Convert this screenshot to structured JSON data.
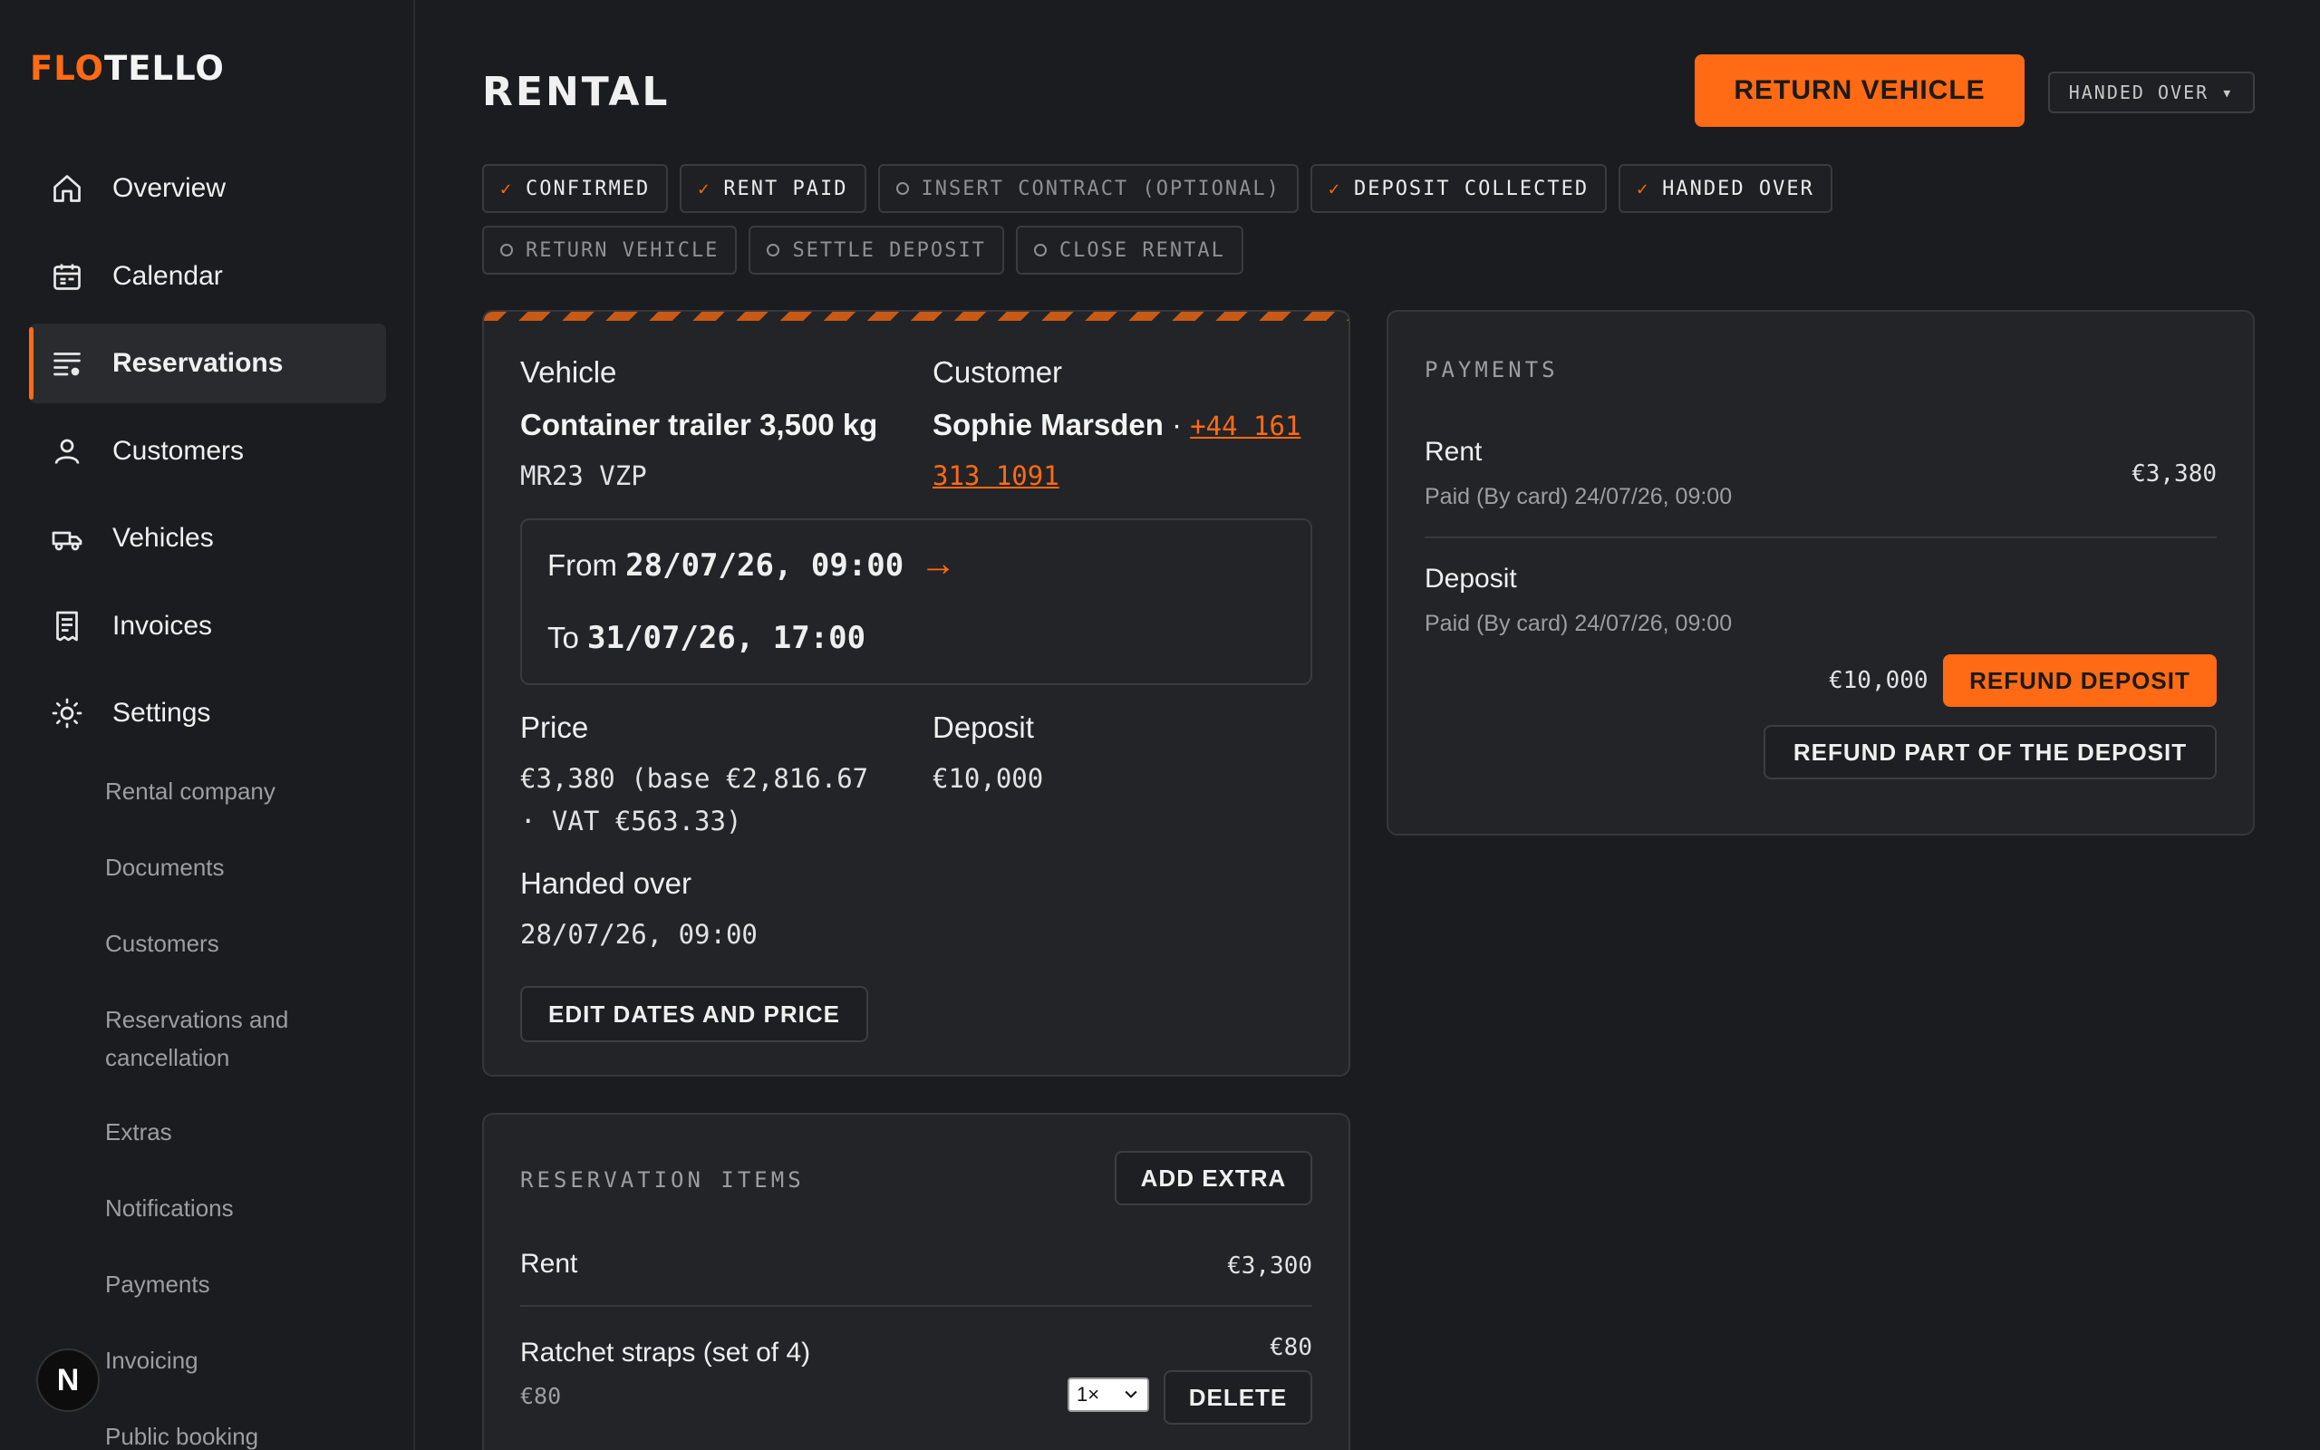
{
  "app": {
    "logo_accent": "FLO",
    "logo_rest": "TELLO",
    "accent_color": "#ff6a14"
  },
  "sidebar": {
    "items": [
      {
        "label": "Overview",
        "icon": "home-icon"
      },
      {
        "label": "Calendar",
        "icon": "calendar-icon"
      },
      {
        "label": "Reservations",
        "icon": "list-icon",
        "active": true
      },
      {
        "label": "Customers",
        "icon": "user-icon"
      },
      {
        "label": "Vehicles",
        "icon": "truck-icon"
      },
      {
        "label": "Invoices",
        "icon": "receipt-icon"
      },
      {
        "label": "Settings",
        "icon": "gear-icon"
      }
    ],
    "settings_items": [
      "Rental company",
      "Documents",
      "Customers",
      "Reservations and cancellation",
      "Extras",
      "Notifications",
      "Payments",
      "Invoicing",
      "Public booking"
    ],
    "avatar_letter": "N"
  },
  "header": {
    "title": "RENTAL",
    "primary_action": "RETURN VEHICLE",
    "status_select": "HANDED OVER ▾"
  },
  "steps": [
    {
      "label": "CONFIRMED",
      "done": true
    },
    {
      "label": "RENT PAID",
      "done": true
    },
    {
      "label": "INSERT CONTRACT (OPTIONAL)",
      "done": false
    },
    {
      "label": "DEPOSIT COLLECTED",
      "done": true
    },
    {
      "label": "HANDED OVER",
      "done": true
    },
    {
      "label": "RETURN VEHICLE",
      "done": false
    },
    {
      "label": "SETTLE DEPOSIT",
      "done": false
    },
    {
      "label": "CLOSE RENTAL",
      "done": false
    }
  ],
  "rental": {
    "vehicle_label": "Vehicle",
    "vehicle_name": "Container trailer 3,500 kg",
    "plate": "MR23 VZP",
    "customer_label": "Customer",
    "customer_name": "Sophie Marsden",
    "separator": " · ",
    "phone_line1": "+44 161",
    "phone_line2": "313 1091",
    "from_label": "From",
    "from_value": "28/07/26, 09:00",
    "arrow": "→",
    "to_label": "To",
    "to_value": "31/07/26, 17:00",
    "price_label": "Price",
    "price_line1": "€3,380 (base €2,816.67",
    "price_line2": "· VAT €563.33)",
    "deposit_label": "Deposit",
    "deposit_value": "€10,000",
    "handed_label": "Handed over",
    "handed_value": "28/07/26, 09:00",
    "edit_button": "EDIT DATES AND PRICE"
  },
  "payments": {
    "title": "PAYMENTS",
    "rent_label": "Rent",
    "rent_sub": "Paid (By card) 24/07/26, 09:00",
    "rent_amount": "€3,380",
    "deposit_label": "Deposit",
    "deposit_sub": "Paid (By card) 24/07/26, 09:00",
    "deposit_amount": "€10,000",
    "refund_button": "REFUND DEPOSIT",
    "refund_part_button": "REFUND PART OF THE DEPOSIT"
  },
  "items": {
    "title": "RESERVATION ITEMS",
    "add_button": "ADD EXTRA",
    "rows": [
      {
        "name": "Rent",
        "amount": "€3,300"
      },
      {
        "name": "Ratchet straps (set of 4)",
        "unit_price": "€80",
        "amount": "€80",
        "qty": "1×",
        "delete_label": "DELETE"
      }
    ]
  }
}
